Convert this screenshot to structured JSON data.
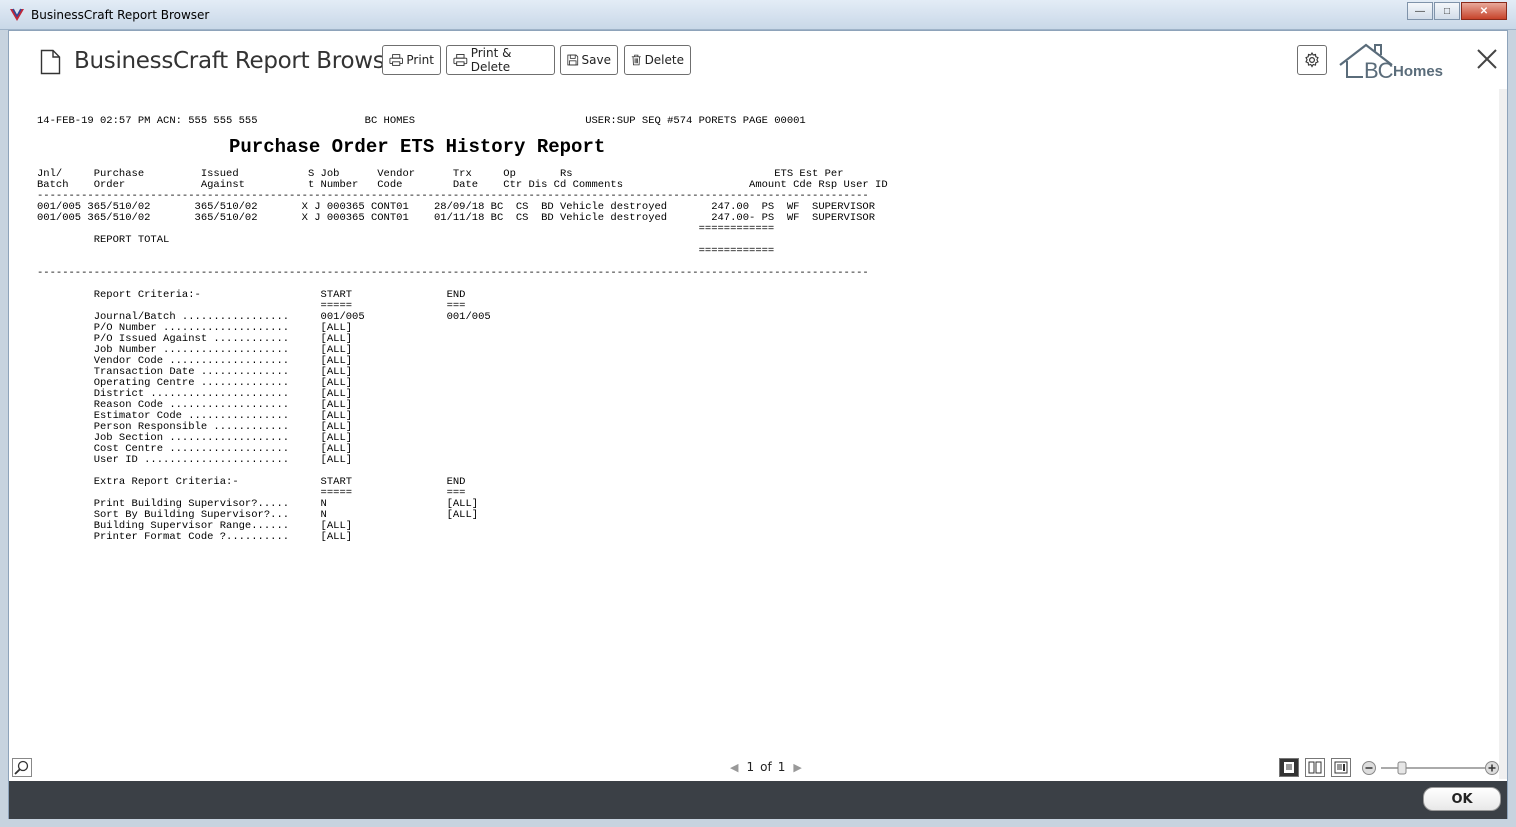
{
  "window": {
    "title": "BusinessCraft Report Browser"
  },
  "app": {
    "title": "BusinessCraft Report Browser",
    "toolbar": {
      "print": "Print",
      "print_delete": "Print & Delete",
      "save": "Save",
      "delete": "Delete"
    },
    "brand": {
      "bc": "BC",
      "homes": "Homes"
    }
  },
  "report": {
    "header_line": "14-FEB-19 02:57 PM ACN: 555 555 555                 BC HOMES                           USER:SUP SEQ #574 PORETS PAGE 00001",
    "title": "Purchase Order ETS History Report",
    "col_hdr_1": "Jnl/     Purchase         Issued           S Job      Vendor      Trx     Op       Rs                                ETS Est Per",
    "col_hdr_2": "Batch    Order            Against          t Number   Code        Date    Ctr Dis Cd Comments                    Amount Cde Rsp User ID",
    "sep_dash": "------------------------------------------------------------------------------------------------------------------------------------",
    "rows": [
      "001/005 365/510/02       365/510/02       X J 000365 CONT01    28/09/18 BC  CS  BD Vehicle destroyed       247.00  PS  WF  SUPERVISOR",
      "001/005 365/510/02       365/510/02       X J 000365 CONT01    01/11/18 BC  CS  BD Vehicle destroyed       247.00- PS  WF  SUPERVISOR"
    ],
    "eq_line_1": "                                                                                                         ============",
    "total_line": "         REPORT TOTAL",
    "eq_line_2": "                                                                                                         ============",
    "sep_dash_2": "------------------------------------------------------------------------------------------------------------------------------------",
    "criteria": [
      "         Report Criteria:-                   START               END",
      "                                             =====               ===",
      "         Journal/Batch .................     001/005             001/005",
      "         P/O Number ....................     [ALL]",
      "         P/O Issued Against ............     [ALL]",
      "         Job Number ....................     [ALL]",
      "         Vendor Code ...................     [ALL]",
      "         Transaction Date ..............     [ALL]",
      "         Operating Centre ..............     [ALL]",
      "         District ......................     [ALL]",
      "         Reason Code ...................     [ALL]",
      "         Estimator Code ................     [ALL]",
      "         Person Responsible ............     [ALL]",
      "         Job Section ...................     [ALL]",
      "         Cost Centre ...................     [ALL]",
      "         User ID .......................     [ALL]",
      "",
      "         Extra Report Criteria:-             START               END",
      "                                             =====               ===",
      "         Print Building Supervisor?.....     N                   [ALL]",
      "         Sort By Building Supervisor?...     N                   [ALL]",
      "         Building Supervisor Range......     [ALL]",
      "         Printer Format Code ?..........     [ALL]"
    ]
  },
  "pager": {
    "current": "1",
    "of": "of",
    "total": "1"
  },
  "footer": {
    "ok": "OK"
  }
}
